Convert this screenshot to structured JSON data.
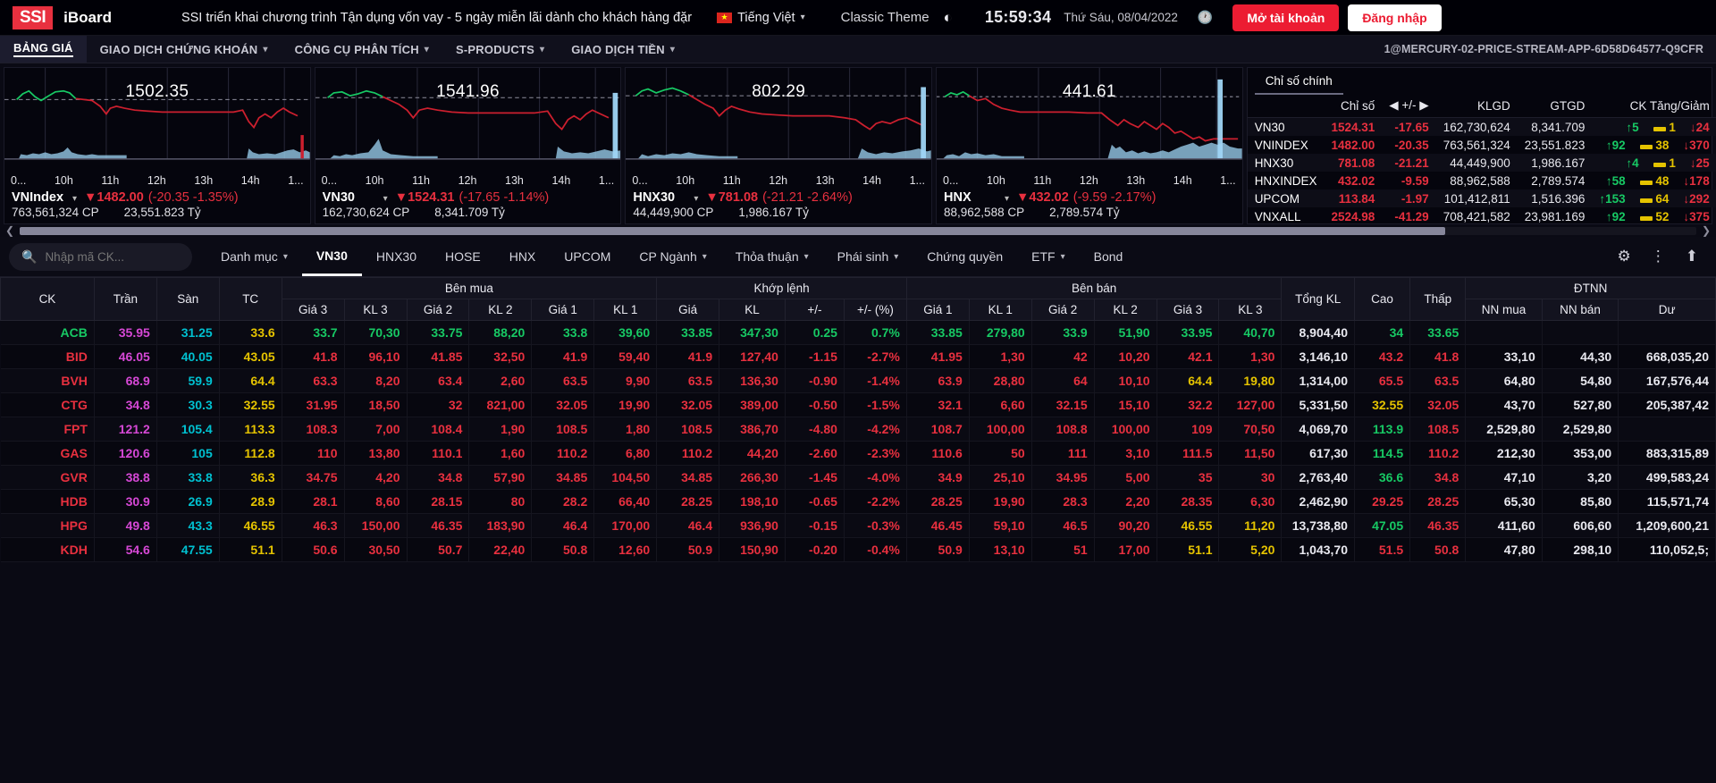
{
  "header": {
    "logo_mark": "SSI",
    "logo_text": "iBoard",
    "promo": "SSI triển khai chương trình Tận dụng vốn vay - 5 ngày miễn lãi dành cho khách hàng đặr",
    "language": "Tiếng Việt",
    "theme": "Classic Theme",
    "time": "15:59:34",
    "date": "Thứ Sáu, 08/04/2022",
    "open_account": "Mở tài khoản",
    "login": "Đăng nhập"
  },
  "mainnav": {
    "items": [
      {
        "label": "BẢNG GIÁ",
        "caret": false,
        "active": true
      },
      {
        "label": "GIAO DỊCH CHỨNG KHOÁN",
        "caret": true,
        "active": false
      },
      {
        "label": "CÔNG CỤ PHÂN TÍCH",
        "caret": true,
        "active": false
      },
      {
        "label": "S-PRODUCTS",
        "caret": true,
        "active": false
      },
      {
        "label": "GIAO DỊCH TIỀN",
        "caret": true,
        "active": false
      }
    ],
    "stream_id": "1@MERCURY-02-PRICE-STREAM-APP-6D58D64577-Q9CFR"
  },
  "index_cards": [
    {
      "name": "VNIndex",
      "value": "1482.00",
      "float_value": "1502.35",
      "change": "(-20.35  -1.35%)",
      "volume": "763,561,324 CP",
      "turnover": "23,551.823 Tỷ",
      "axis": [
        "0...",
        "10h",
        "11h",
        "12h",
        "13h",
        "14h",
        "1..."
      ],
      "direction": "down"
    },
    {
      "name": "VN30",
      "value": "1524.31",
      "float_value": "1541.96",
      "change": "(-17.65  -1.14%)",
      "volume": "162,730,624 CP",
      "turnover": "8,341.709 Tỷ",
      "axis": [
        "0...",
        "10h",
        "11h",
        "12h",
        "13h",
        "14h",
        "1..."
      ],
      "direction": "down"
    },
    {
      "name": "HNX30",
      "value": "781.08",
      "float_value": "802.29",
      "change": "(-21.21  -2.64%)",
      "volume": "44,449,900 CP",
      "turnover": "1,986.167 Tỷ",
      "axis": [
        "0...",
        "10h",
        "11h",
        "12h",
        "13h",
        "14h",
        "1..."
      ],
      "direction": "down"
    },
    {
      "name": "HNX",
      "value": "432.02",
      "float_value": "441.61",
      "change": "(-9.59  -2.17%)",
      "volume": "88,962,588 CP",
      "turnover": "2,789.574 Tỷ",
      "axis": [
        "0...",
        "10h",
        "11h",
        "12h",
        "13h",
        "14h",
        "1..."
      ],
      "direction": "down"
    }
  ],
  "index_panel": {
    "tab": "Chỉ số chính",
    "columns": [
      "",
      "Chỉ số",
      "+/-",
      "KLGD",
      "GTGD",
      "CK Tăng/Giảm"
    ],
    "rows": [
      {
        "name": "VN30",
        "index": "1524.31",
        "change": "-17.65",
        "klgd": "162,730,624",
        "gtgd": "8,341.709",
        "up": "5",
        "ref": "1",
        "down": "24"
      },
      {
        "name": "VNINDEX",
        "index": "1482.00",
        "change": "-20.35",
        "klgd": "763,561,324",
        "gtgd": "23,551.823",
        "up": "92",
        "ref": "38",
        "down": "370"
      },
      {
        "name": "HNX30",
        "index": "781.08",
        "change": "-21.21",
        "klgd": "44,449,900",
        "gtgd": "1,986.167",
        "up": "4",
        "ref": "1",
        "down": "25"
      },
      {
        "name": "HNXINDEX",
        "index": "432.02",
        "change": "-9.59",
        "klgd": "88,962,588",
        "gtgd": "2,789.574",
        "up": "58",
        "ref": "48",
        "down": "178"
      },
      {
        "name": "UPCOM",
        "index": "113.84",
        "change": "-1.97",
        "klgd": "101,412,811",
        "gtgd": "1,516.396",
        "up": "153",
        "ref": "64",
        "down": "292"
      },
      {
        "name": "VNXALL",
        "index": "2524.98",
        "change": "-41.29",
        "klgd": "708,421,582",
        "gtgd": "23,981.169",
        "up": "92",
        "ref": "52",
        "down": "375"
      }
    ]
  },
  "filterbar": {
    "search_placeholder": "Nhập mã CK...",
    "search_value": "",
    "tabs": [
      {
        "label": "Danh mục",
        "caret": true,
        "active": false
      },
      {
        "label": "VN30",
        "caret": false,
        "active": true
      },
      {
        "label": "HNX30",
        "caret": false,
        "active": false
      },
      {
        "label": "HOSE",
        "caret": false,
        "active": false
      },
      {
        "label": "HNX",
        "caret": false,
        "active": false
      },
      {
        "label": "UPCOM",
        "caret": false,
        "active": false
      },
      {
        "label": "CP Ngành",
        "caret": true,
        "active": false
      },
      {
        "label": "Thỏa thuận",
        "caret": true,
        "active": false
      },
      {
        "label": "Phái sinh",
        "caret": true,
        "active": false
      },
      {
        "label": "Chứng quyền",
        "caret": false,
        "active": false
      },
      {
        "label": "ETF",
        "caret": true,
        "active": false
      },
      {
        "label": "Bond",
        "caret": false,
        "active": false
      }
    ]
  },
  "price_table": {
    "group_headers": [
      {
        "label": "CK",
        "span": 1,
        "rowspan": 2
      },
      {
        "label": "Trần",
        "span": 1,
        "rowspan": 2
      },
      {
        "label": "Sàn",
        "span": 1,
        "rowspan": 2
      },
      {
        "label": "TC",
        "span": 1,
        "rowspan": 2
      },
      {
        "label": "Bên mua",
        "span": 6,
        "rowspan": 1
      },
      {
        "label": "Khớp lệnh",
        "span": 4,
        "rowspan": 1
      },
      {
        "label": "Bên bán",
        "span": 6,
        "rowspan": 1
      },
      {
        "label": "Tổng KL",
        "span": 1,
        "rowspan": 2
      },
      {
        "label": "Cao",
        "span": 1,
        "rowspan": 2
      },
      {
        "label": "Thấp",
        "span": 1,
        "rowspan": 2
      },
      {
        "label": "ĐTNN",
        "span": 3,
        "rowspan": 1
      }
    ],
    "sub_headers": [
      "Giá 3",
      "KL 3",
      "Giá 2",
      "KL 2",
      "Giá 1",
      "KL 1",
      "Giá",
      "KL",
      "+/-",
      "+/- (%)",
      "Giá 1",
      "KL 1",
      "Giá 2",
      "KL 2",
      "Giá 3",
      "KL 3",
      "NN mua",
      "NN bán",
      "Dư"
    ],
    "rows": [
      {
        "sym": "ACB",
        "sym_c": "c-up",
        "ceil": "35.95",
        "floor": "31.25",
        "ref": "33.6",
        "b3": "33.7",
        "b3v": "70,30",
        "b3c": "c-up",
        "b2": "33.75",
        "b2v": "88,20",
        "b2c": "c-up",
        "b1": "33.8",
        "b1v": "39,60",
        "b1c": "c-up",
        "match": "33.85",
        "mvol": "347,30",
        "chg": "0.25",
        "chgp": "0.7%",
        "mc": "c-up",
        "s1": "33.85",
        "s1v": "279,80",
        "s1c": "c-up",
        "s2": "33.9",
        "s2v": "51,90",
        "s2c": "c-up",
        "s3": "33.95",
        "s3v": "40,70",
        "s3c": "c-up",
        "total": "8,904,40",
        "totc": "c-wht",
        "high": "34",
        "highc": "c-up",
        "low": "33.65",
        "lowc": "c-up",
        "nnmua": "",
        "nnban": "",
        "du": ""
      },
      {
        "sym": "BID",
        "sym_c": "c-dn",
        "ceil": "46.05",
        "floor": "40.05",
        "ref": "43.05",
        "b3": "41.8",
        "b3v": "96,10",
        "b3c": "c-dn",
        "b2": "41.85",
        "b2v": "32,50",
        "b2c": "c-dn",
        "b1": "41.9",
        "b1v": "59,40",
        "b1c": "c-dn",
        "match": "41.9",
        "mvol": "127,40",
        "chg": "-1.15",
        "chgp": "-2.7%",
        "mc": "c-dn",
        "s1": "41.95",
        "s1v": "1,30",
        "s1c": "c-dn",
        "s2": "42",
        "s2v": "10,20",
        "s2c": "c-dn",
        "s3": "42.1",
        "s3v": "1,30",
        "s3c": "c-dn",
        "total": "3,146,10",
        "totc": "c-wht",
        "high": "43.2",
        "highc": "c-dn",
        "low": "41.8",
        "lowc": "c-dn",
        "nnmua": "33,10",
        "nnban": "44,30",
        "du": "668,035,20"
      },
      {
        "sym": "BVH",
        "sym_c": "c-dn",
        "ceil": "68.9",
        "floor": "59.9",
        "ref": "64.4",
        "b3": "63.3",
        "b3v": "8,20",
        "b3c": "c-dn",
        "b2": "63.4",
        "b2v": "2,60",
        "b2c": "c-dn",
        "b1": "63.5",
        "b1v": "9,90",
        "b1c": "c-dn",
        "match": "63.5",
        "mvol": "136,30",
        "chg": "-0.90",
        "chgp": "-1.4%",
        "mc": "c-dn",
        "s1": "63.9",
        "s1v": "28,80",
        "s1c": "c-dn",
        "s2": "64",
        "s2v": "10,10",
        "s2c": "c-dn",
        "s3": "64.4",
        "s3v": "19,80",
        "s3c": "c-ref",
        "total": "1,314,00",
        "totc": "c-wht",
        "high": "65.5",
        "highc": "c-dn",
        "low": "63.5",
        "lowc": "c-dn",
        "nnmua": "64,80",
        "nnban": "54,80",
        "du": "167,576,44"
      },
      {
        "sym": "CTG",
        "sym_c": "c-dn",
        "ceil": "34.8",
        "floor": "30.3",
        "ref": "32.55",
        "b3": "31.95",
        "b3v": "18,50",
        "b3c": "c-dn",
        "b2": "32",
        "b2v": "821,00",
        "b2c": "c-dn",
        "b1": "32.05",
        "b1v": "19,90",
        "b1c": "c-dn",
        "match": "32.05",
        "mvol": "389,00",
        "chg": "-0.50",
        "chgp": "-1.5%",
        "mc": "c-dn",
        "s1": "32.1",
        "s1v": "6,60",
        "s1c": "c-dn",
        "s2": "32.15",
        "s2v": "15,10",
        "s2c": "c-dn",
        "s3": "32.2",
        "s3v": "127,00",
        "s3c": "c-dn",
        "total": "5,331,50",
        "totc": "c-wht",
        "high": "32.55",
        "highc": "c-ref",
        "low": "32.05",
        "lowc": "c-dn",
        "nnmua": "43,70",
        "nnban": "527,80",
        "du": "205,387,42"
      },
      {
        "sym": "FPT",
        "sym_c": "c-dn",
        "ceil": "121.2",
        "floor": "105.4",
        "ref": "113.3",
        "b3": "108.3",
        "b3v": "7,00",
        "b3c": "c-dn",
        "b2": "108.4",
        "b2v": "1,90",
        "b2c": "c-dn",
        "b1": "108.5",
        "b1v": "1,80",
        "b1c": "c-dn",
        "match": "108.5",
        "mvol": "386,70",
        "chg": "-4.80",
        "chgp": "-4.2%",
        "mc": "c-dn",
        "s1": "108.7",
        "s1v": "100,00",
        "s1c": "c-dn",
        "s2": "108.8",
        "s2v": "100,00",
        "s2c": "c-dn",
        "s3": "109",
        "s3v": "70,50",
        "s3c": "c-dn",
        "total": "4,069,70",
        "totc": "c-wht",
        "high": "113.9",
        "highc": "c-up",
        "low": "108.5",
        "lowc": "c-dn",
        "nnmua": "2,529,80",
        "nnban": "2,529,80",
        "du": ""
      },
      {
        "sym": "GAS",
        "sym_c": "c-dn",
        "ceil": "120.6",
        "floor": "105",
        "ref": "112.8",
        "b3": "110",
        "b3v": "13,80",
        "b3c": "c-dn",
        "b2": "110.1",
        "b2v": "1,60",
        "b2c": "c-dn",
        "b1": "110.2",
        "b1v": "6,80",
        "b1c": "c-dn",
        "match": "110.2",
        "mvol": "44,20",
        "chg": "-2.60",
        "chgp": "-2.3%",
        "mc": "c-dn",
        "s1": "110.6",
        "s1v": "50",
        "s1c": "c-dn",
        "s2": "111",
        "s2v": "3,10",
        "s2c": "c-dn",
        "s3": "111.5",
        "s3v": "11,50",
        "s3c": "c-dn",
        "total": "617,30",
        "totc": "c-wht",
        "high": "114.5",
        "highc": "c-up",
        "low": "110.2",
        "lowc": "c-dn",
        "nnmua": "212,30",
        "nnban": "353,00",
        "du": "883,315,89"
      },
      {
        "sym": "GVR",
        "sym_c": "c-dn",
        "ceil": "38.8",
        "floor": "33.8",
        "ref": "36.3",
        "b3": "34.75",
        "b3v": "4,20",
        "b3c": "c-dn",
        "b2": "34.8",
        "b2v": "57,90",
        "b2c": "c-dn",
        "b1": "34.85",
        "b1v": "104,50",
        "b1c": "c-dn",
        "match": "34.85",
        "mvol": "266,30",
        "chg": "-1.45",
        "chgp": "-4.0%",
        "mc": "c-dn",
        "s1": "34.9",
        "s1v": "25,10",
        "s1c": "c-dn",
        "s2": "34.95",
        "s2v": "5,00",
        "s2c": "c-dn",
        "s3": "35",
        "s3v": "30",
        "s3c": "c-dn",
        "total": "2,763,40",
        "totc": "c-wht",
        "high": "36.6",
        "highc": "c-up",
        "low": "34.8",
        "lowc": "c-dn",
        "nnmua": "47,10",
        "nnban": "3,20",
        "du": "499,583,24"
      },
      {
        "sym": "HDB",
        "sym_c": "c-dn",
        "ceil": "30.9",
        "floor": "26.9",
        "ref": "28.9",
        "b3": "28.1",
        "b3v": "8,60",
        "b3c": "c-dn",
        "b2": "28.15",
        "b2v": "80",
        "b2c": "c-dn",
        "b1": "28.2",
        "b1v": "66,40",
        "b1c": "c-dn",
        "match": "28.25",
        "mvol": "198,10",
        "chg": "-0.65",
        "chgp": "-2.2%",
        "mc": "c-dn",
        "s1": "28.25",
        "s1v": "19,90",
        "s1c": "c-dn",
        "s2": "28.3",
        "s2v": "2,20",
        "s2c": "c-dn",
        "s3": "28.35",
        "s3v": "6,30",
        "s3c": "c-dn",
        "total": "2,462,90",
        "totc": "c-wht",
        "high": "29.25",
        "highc": "c-dn",
        "low": "28.25",
        "lowc": "c-dn",
        "nnmua": "65,30",
        "nnban": "85,80",
        "du": "115,571,74"
      },
      {
        "sym": "HPG",
        "sym_c": "c-dn",
        "ceil": "49.8",
        "floor": "43.3",
        "ref": "46.55",
        "b3": "46.3",
        "b3v": "150,00",
        "b3c": "c-dn",
        "b2": "46.35",
        "b2v": "183,90",
        "b2c": "c-dn",
        "b1": "46.4",
        "b1v": "170,00",
        "b1c": "c-dn",
        "match": "46.4",
        "mvol": "936,90",
        "chg": "-0.15",
        "chgp": "-0.3%",
        "mc": "c-dn",
        "s1": "46.45",
        "s1v": "59,10",
        "s1c": "c-dn",
        "s2": "46.5",
        "s2v": "90,20",
        "s2c": "c-dn",
        "s3": "46.55",
        "s3v": "11,20",
        "s3c": "c-ref",
        "total": "13,738,80",
        "totc": "c-wht",
        "high": "47.05",
        "highc": "c-up",
        "low": "46.35",
        "lowc": "c-dn",
        "nnmua": "411,60",
        "nnban": "606,60",
        "du": "1,209,600,21"
      },
      {
        "sym": "KDH",
        "sym_c": "c-dn",
        "ceil": "54.6",
        "floor": "47.55",
        "ref": "51.1",
        "b3": "50.6",
        "b3v": "30,50",
        "b3c": "c-dn",
        "b2": "50.7",
        "b2v": "22,40",
        "b2c": "c-dn",
        "b1": "50.8",
        "b1v": "12,60",
        "b1c": "c-dn",
        "match": "50.9",
        "mvol": "150,90",
        "chg": "-0.20",
        "chgp": "-0.4%",
        "mc": "c-dn",
        "s1": "50.9",
        "s1v": "13,10",
        "s1c": "c-dn",
        "s2": "51",
        "s2v": "17,00",
        "s2c": "c-dn",
        "s3": "51.1",
        "s3v": "5,20",
        "s3c": "c-ref",
        "total": "1,043,70",
        "totc": "c-wht",
        "high": "51.5",
        "highc": "c-dn",
        "low": "50.8",
        "lowc": "c-dn",
        "nnmua": "47,80",
        "nnban": "298,10",
        "du": "110,052,5;"
      }
    ]
  },
  "colors": {
    "ceiling": "#d648d6",
    "floor": "#00c0d0",
    "reference": "#e5c300",
    "up": "#17c964",
    "down": "#e8303f",
    "brand_red": "#ec1c32"
  }
}
